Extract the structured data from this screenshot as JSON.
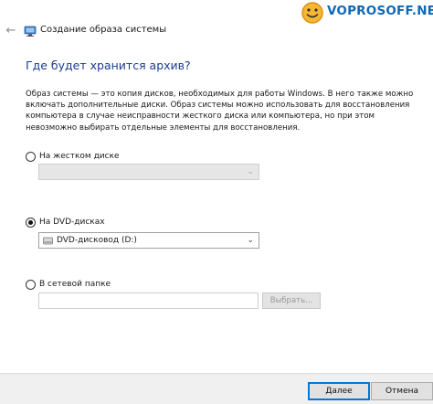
{
  "window": {
    "title": "Создание образа системы"
  },
  "watermark": {
    "text": "VOPROSOFF.NET",
    "logo_icon": "smiley-face-logo"
  },
  "page": {
    "heading": "Где будет хранится архив?",
    "description": "Образ системы — это копия дисков, необходимых для работы Windows. В него также можно включать дополнительные диски. Образ системы можно использовать для восстановления компьютера в случае неисправности жесткого диска или компьютера, но при этом невозможно выбирать отдельные элементы для восстановления."
  },
  "options": {
    "hard_disk": {
      "label": "На жестком диске",
      "selected": false,
      "select_value": ""
    },
    "dvd": {
      "label": "На DVD-дисках",
      "selected": true,
      "select_value": "DVD-дисковод (D:)"
    },
    "network": {
      "label": "В сетевой папке",
      "selected": false,
      "input_value": "",
      "browse_label": "Выбрать..."
    }
  },
  "footer": {
    "next_label": "Далее",
    "cancel_label": "Отмена"
  },
  "colors": {
    "heading": "#1a3d8f",
    "watermark": "#0f69b5",
    "primary_border": "#0078d7"
  }
}
